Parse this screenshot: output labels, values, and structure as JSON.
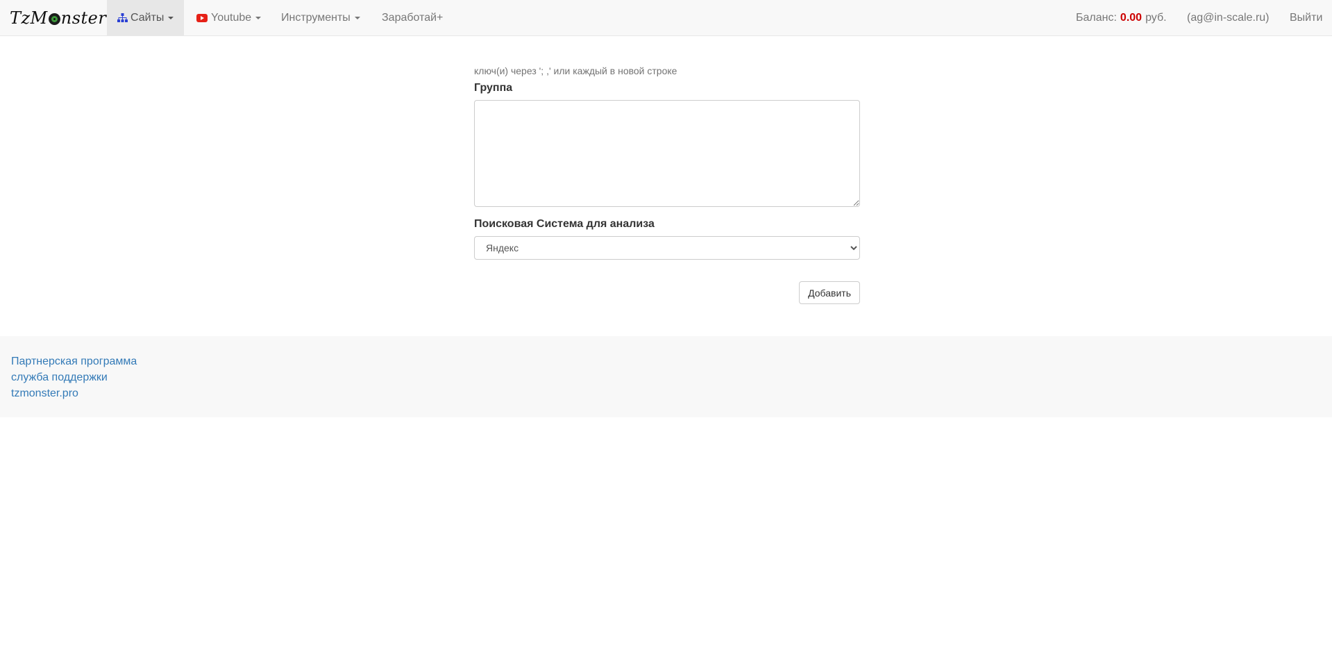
{
  "navbar": {
    "brand": {
      "before": "TzM",
      "after": "nster"
    },
    "menu": [
      {
        "label": "Сайты",
        "icon": "sitemap-icon",
        "active": true
      },
      {
        "label": "Youtube",
        "icon": "youtube-icon"
      },
      {
        "label": "Инструменты"
      },
      {
        "label": "Заработай+"
      }
    ],
    "balance": {
      "label": "Баланс:",
      "amount": "0.00",
      "currency": "руб.",
      "amount_color": "#cc0000"
    },
    "user_email": "(ag@in-scale.ru)",
    "logout_label": "Выйти"
  },
  "form": {
    "help_text": "ключ(и) через ';  ,' или каждый в новой строке",
    "group_label": "Группа",
    "group_value": "",
    "engine_label": "Поисковая Система для анализа",
    "engine_selected": "Яндекс",
    "add_button_label": "Добавить"
  },
  "footer": {
    "links": [
      "Партнерская программа",
      "служба поддержки",
      "tzmonster.pro"
    ],
    "link_color": "#337ab7"
  }
}
